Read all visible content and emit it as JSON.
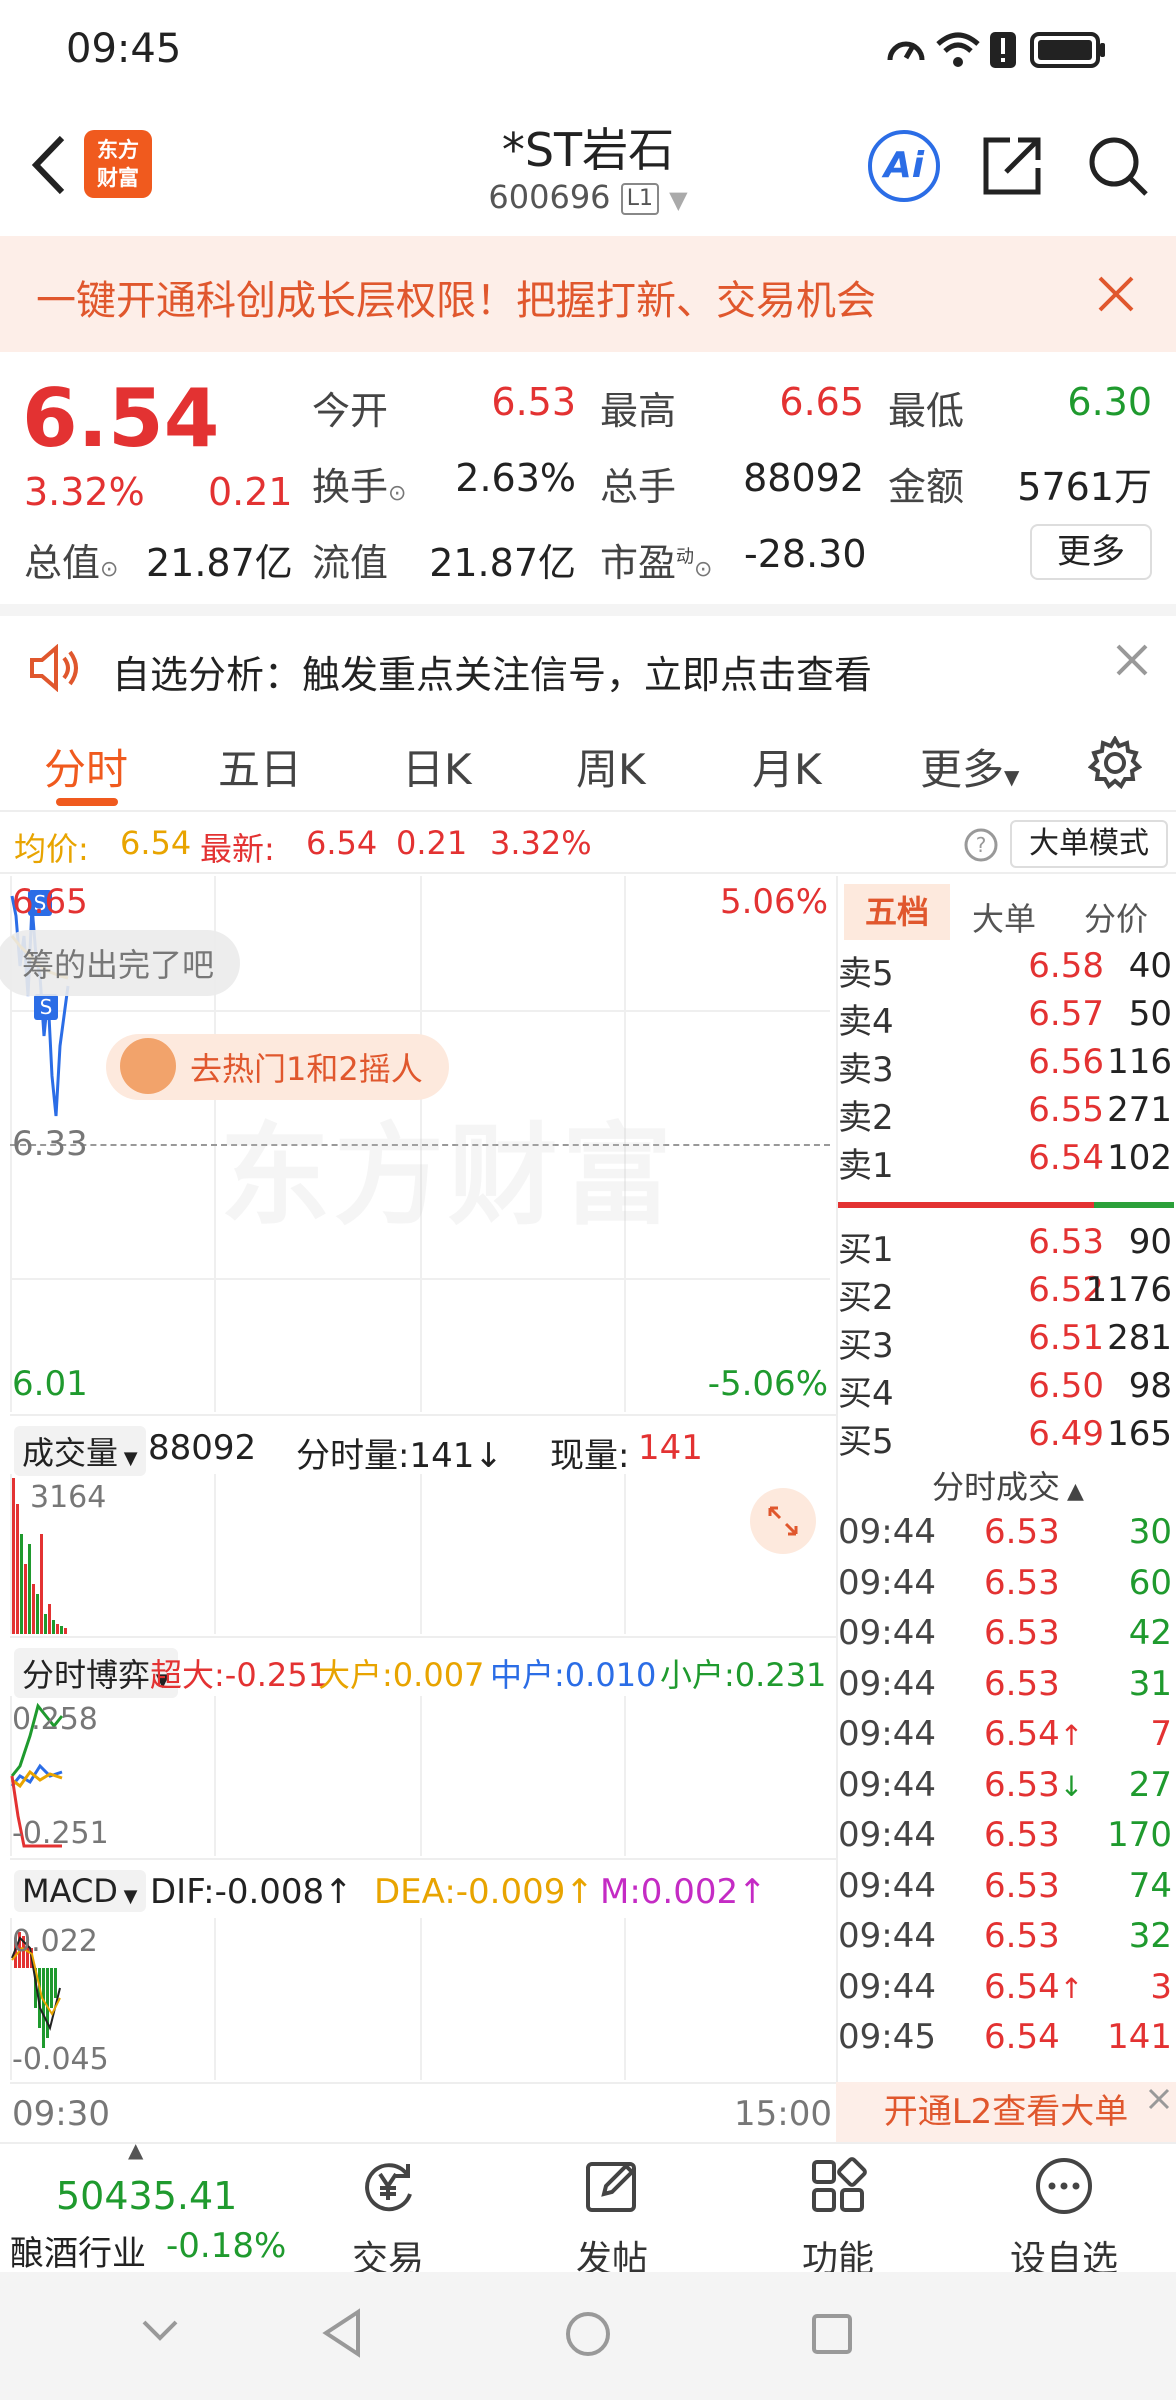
{
  "status_bar": {
    "time": "09:45"
  },
  "header": {
    "stock_name": "*ST岩石",
    "stock_code": "600696",
    "level_badge": "L1",
    "logo_line1": "东方",
    "logo_line2": "财富",
    "ai_label": "Ai"
  },
  "promo_banner": {
    "text": "一键开通科创成长层权限！把握打新、交易机会"
  },
  "quote": {
    "price": "6.54",
    "pct_change": "3.32%",
    "abs_change": "0.21",
    "open_label": "今开",
    "open_value": "6.53",
    "high_label": "最高",
    "high_value": "6.65",
    "low_label": "最低",
    "low_value": "6.30",
    "turnover_label": "换手",
    "turnover_value": "2.63%",
    "volume_label": "总手",
    "volume_value": "88092",
    "amount_label": "金额",
    "amount_value": "5761万",
    "mkt_cap_label": "总值",
    "mkt_cap_value": "21.87亿",
    "float_cap_label": "流值",
    "float_cap_value": "21.87亿",
    "pe_label": "市盈",
    "pe_superscript": "动",
    "pe_value": "-28.30",
    "more_label": "更多"
  },
  "analysis": {
    "text": "自选分析：触发重点关注信号，立即点击查看"
  },
  "tabs": [
    "分时",
    "五日",
    "日K",
    "周K",
    "月K",
    "更多"
  ],
  "avg_row": {
    "avg_label": "均价:",
    "avg_value": "6.54",
    "latest_label": "最新:",
    "latest_value": "6.54",
    "change": "0.21",
    "pct": "3.32%",
    "big_order_mode": "大单模式"
  },
  "main_chart": {
    "y_top_left": "6.65",
    "y_mid_left": "6.33",
    "y_bottom_left": "6.01",
    "y_top_right": "5.06%",
    "y_bottom_right": "-5.06%",
    "bubble_1": "筹的出完了吧",
    "bubble_2": "去热门1和2摇人",
    "watermark": "东方财富",
    "marker_1": "S",
    "marker_2": "S"
  },
  "order_book": {
    "tabs": [
      "五档",
      "大单",
      "分价"
    ],
    "sells": [
      {
        "label": "卖5",
        "price": "6.58",
        "vol": "40"
      },
      {
        "label": "卖4",
        "price": "6.57",
        "vol": "50"
      },
      {
        "label": "卖3",
        "price": "6.56",
        "vol": "116"
      },
      {
        "label": "卖2",
        "price": "6.55",
        "vol": "271"
      },
      {
        "label": "卖1",
        "price": "6.54",
        "vol": "102"
      }
    ],
    "buys": [
      {
        "label": "买1",
        "price": "6.53",
        "vol": "90"
      },
      {
        "label": "买2",
        "price": "6.52",
        "vol": "1176"
      },
      {
        "label": "买3",
        "price": "6.51",
        "vol": "281"
      },
      {
        "label": "买4",
        "price": "6.50",
        "vol": "98"
      },
      {
        "label": "买5",
        "price": "6.49",
        "vol": "165"
      }
    ],
    "trades_header": "分时成交",
    "trades": [
      {
        "time": "09:44",
        "price": "6.53",
        "vol": "30",
        "arrow": "",
        "pc": "red",
        "vc": "green"
      },
      {
        "time": "09:44",
        "price": "6.53",
        "vol": "60",
        "arrow": "",
        "pc": "red",
        "vc": "green"
      },
      {
        "time": "09:44",
        "price": "6.53",
        "vol": "42",
        "arrow": "",
        "pc": "red",
        "vc": "green"
      },
      {
        "time": "09:44",
        "price": "6.53",
        "vol": "31",
        "arrow": "",
        "pc": "red",
        "vc": "green"
      },
      {
        "time": "09:44",
        "price": "6.54",
        "vol": "7",
        "arrow": "↑",
        "pc": "red",
        "vc": "red"
      },
      {
        "time": "09:44",
        "price": "6.53",
        "vol": "27",
        "arrow": "↓",
        "pc": "red",
        "vc": "green"
      },
      {
        "time": "09:44",
        "price": "6.53",
        "vol": "170",
        "arrow": "",
        "pc": "red",
        "vc": "green"
      },
      {
        "time": "09:44",
        "price": "6.53",
        "vol": "74",
        "arrow": "",
        "pc": "red",
        "vc": "green"
      },
      {
        "time": "09:44",
        "price": "6.53",
        "vol": "32",
        "arrow": "",
        "pc": "red",
        "vc": "green"
      },
      {
        "time": "09:44",
        "price": "6.54",
        "vol": "3",
        "arrow": "↑",
        "pc": "red",
        "vc": "red"
      },
      {
        "time": "09:45",
        "price": "6.54",
        "vol": "141",
        "arrow": "",
        "pc": "red",
        "vc": "red"
      }
    ],
    "l2_banner": "开通L2查看大单"
  },
  "volume_panel": {
    "selector": "成交量",
    "total": "88092",
    "tick_label": "分时量:141↓",
    "now_label": "现量:",
    "now_value": "141",
    "max_label": "3164"
  },
  "game_panel": {
    "selector": "分时博弈",
    "super_label": "超大:",
    "super_value": "-0.251",
    "large_label": "大户:",
    "large_value": "0.007",
    "mid_label": "中户:",
    "mid_value": "0.010",
    "small_label": "小户:",
    "small_value": "0.231",
    "y_top": "0.258",
    "y_bottom": "-0.251"
  },
  "macd_panel": {
    "selector": "MACD",
    "dif": "DIF:-0.008↑",
    "dea": "DEA:-0.009↑",
    "m": "M:0.002↑",
    "y_top": "0.022",
    "y_bottom": "-0.045"
  },
  "time_axis": {
    "start": "09:30",
    "end": "15:00"
  },
  "toolbar": {
    "index_value": "50435.41",
    "index_name": "酿酒行业",
    "index_change": "-0.18%",
    "items": [
      "交易",
      "发帖",
      "功能",
      "设自选"
    ]
  },
  "colors": {
    "up": "#e33232",
    "down": "#1f9a2e",
    "accent": "#f05a1e"
  }
}
